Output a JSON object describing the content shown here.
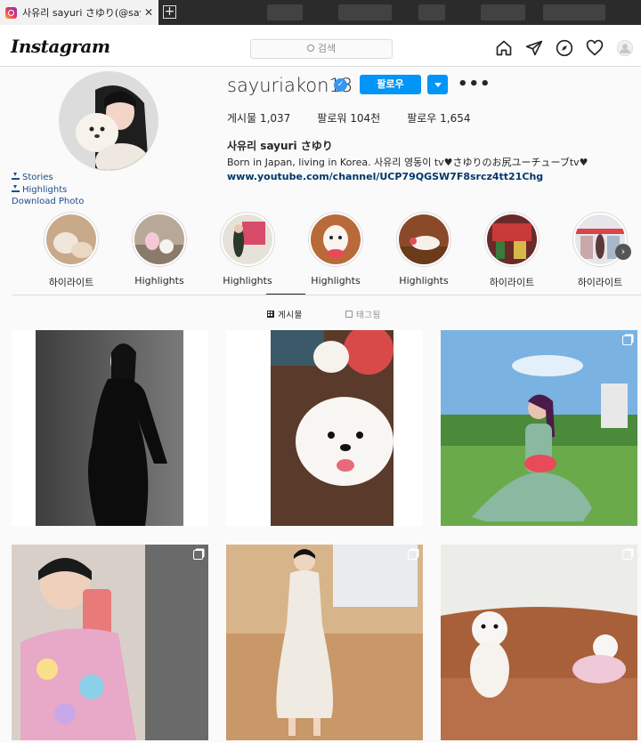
{
  "browser": {
    "tab_title": "사유리 sayuri さゆり(@sayuriakon",
    "tab_close": "✕",
    "new_tab": "+"
  },
  "header": {
    "logo": "Instagram",
    "search_placeholder": "검색"
  },
  "profile": {
    "username": "sayuriakon13",
    "verified_mark": "✓",
    "follow_label": "팔로우",
    "more_label": "•••",
    "stats": {
      "posts": "게시물 1,037",
      "followers": "팔로워 104천",
      "following": "팔로우 1,654"
    },
    "full_name": "사유리 sayuri さゆり",
    "bio": "Born in Japan, living in Korea. 사유리 영동이 tv♥さゆりのお尻ユーチューブtv♥",
    "link": "www.youtube.com/channel/UCP79QGSW7F8srcz4tt21Chg",
    "side_links": {
      "stories": "Stories",
      "highlights": "Highlights",
      "download_photo": "Download Photo"
    }
  },
  "highlights": [
    {
      "label": "하이라이트"
    },
    {
      "label": "Highlights"
    },
    {
      "label": "Highlights"
    },
    {
      "label": "Highlights"
    },
    {
      "label": "Highlights"
    },
    {
      "label": "하이라이트"
    },
    {
      "label": "하이라이트"
    }
  ],
  "highlights_next": "›",
  "tabs": {
    "posts": "게시물",
    "tagged": "태그됨"
  },
  "posts": [
    {
      "name": "maternity-silhouette",
      "multi": false
    },
    {
      "name": "white-puppy-closeup",
      "multi": false
    },
    {
      "name": "woman-sitting-on-grass",
      "multi": true
    },
    {
      "name": "mirror-selfie",
      "multi": true
    },
    {
      "name": "white-dress-portrait",
      "multi": true
    },
    {
      "name": "dogs-on-sofa",
      "multi": true
    }
  ]
}
